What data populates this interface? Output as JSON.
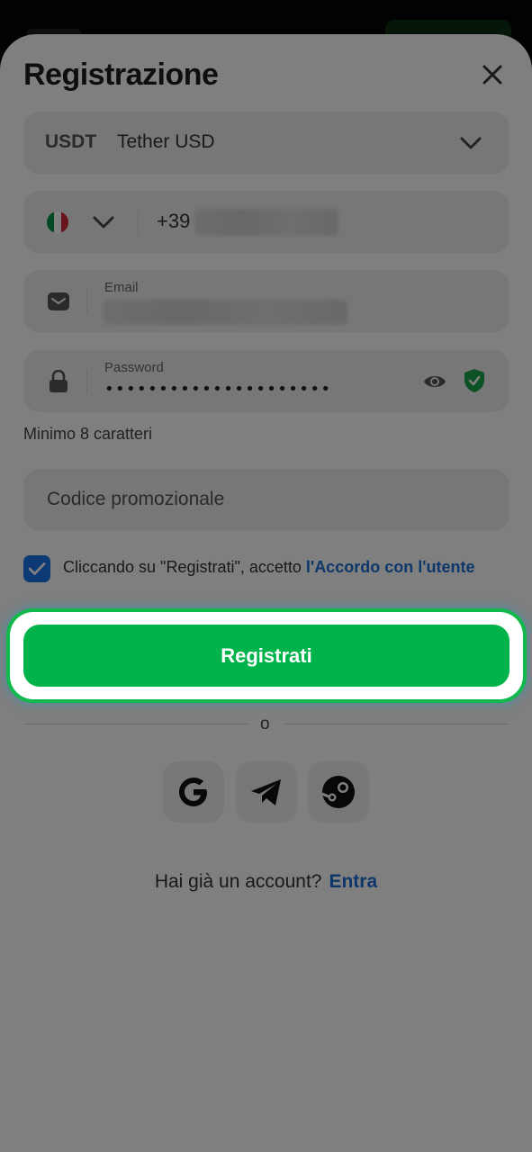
{
  "header": {
    "title": "Registrazione"
  },
  "currency": {
    "code": "USDT",
    "name": "Tether USD"
  },
  "phone": {
    "dial_code": "+39"
  },
  "email": {
    "label": "Email"
  },
  "password": {
    "label": "Password",
    "masked_value": "•••••••••••••••••••••",
    "hint": "Minimo 8 caratteri"
  },
  "promo": {
    "placeholder": "Codice promozionale"
  },
  "agreement": {
    "text": "Cliccando su \"Registrati\", accetto ",
    "link": "l'Accordo con l'utente",
    "checked": true
  },
  "cta": {
    "label": "Registrati"
  },
  "divider": {
    "label": "o"
  },
  "social": [
    "google-icon",
    "telegram-icon",
    "steam-icon"
  ],
  "footer": {
    "question": "Hai già un account?",
    "login_link": "Entra"
  },
  "colors": {
    "accent_green": "#00b34a",
    "link_blue": "#1a6fd6",
    "checkbox_blue": "#1a73e8",
    "shield_green": "#1aa54a",
    "flag_italy": [
      "#009246",
      "#ffffff",
      "#ce2b37"
    ]
  }
}
